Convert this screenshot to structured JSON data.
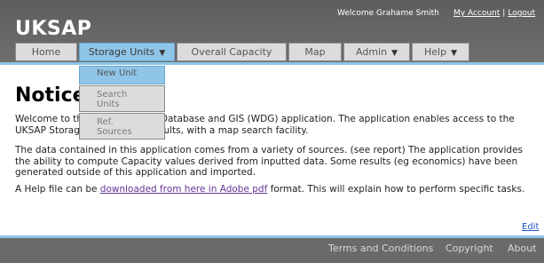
{
  "header": {
    "logo": "UKSAP",
    "welcome": "Welcome Grahame Smith",
    "my_account": "My Account",
    "separator": "|",
    "logout": "Logout"
  },
  "nav": {
    "home": "Home",
    "storage_units": "Storage Units",
    "overall_capacity": "Overall Capacity",
    "map": "Map",
    "admin": "Admin",
    "help": "Help"
  },
  "dropdown": {
    "new_unit": "New Unit",
    "search_line1": "Search",
    "search_line2": "Units",
    "ref_line1": "Ref.",
    "ref_line2": "Sources"
  },
  "content": {
    "title": "Notice",
    "p1_a": "Welcome to th",
    "p1_b": "eled Database and GIS (WDG) application. The application enables access to the",
    "p1_c": "UKSAP Storage",
    "p1_d": "and results, with a map search facility.",
    "p2": "The data contained in this application comes from a variety of sources. (see report) The application provides the ability to compute Capacity values derived from inputted data. Some results (eg economics) have been generated outside of this application and imported.",
    "p3_pre": "A Help file can be ",
    "p3_link": "downloaded from here in Adobe pdf",
    "p3_post": " format. This will explain how to perform specific tasks.",
    "edit": "Edit"
  },
  "footer": {
    "terms": "Terms and Conditions",
    "copyright": "Copyright",
    "about": "About"
  },
  "colors": {
    "header_bg": "#666666",
    "accent_blue": "#8cc4e6",
    "tab_bg": "#dcdcdc"
  }
}
